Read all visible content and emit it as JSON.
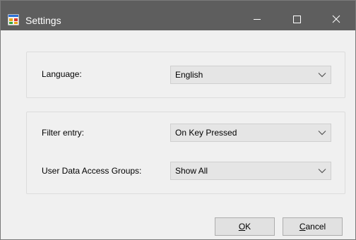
{
  "window": {
    "title": "Settings",
    "app_icon": "settings-app-icon",
    "controls": {
      "minimize_icon": "minimize-icon",
      "maximize_icon": "maximize-icon",
      "close_icon": "close-icon"
    }
  },
  "language_group": {
    "language_label": "Language:",
    "language_value": "English"
  },
  "filter_group": {
    "filter_label": "Filter entry:",
    "filter_value": "On Key Pressed",
    "groups_label": "User Data Access Groups:",
    "groups_value": "Show All"
  },
  "footer": {
    "ok_mnemonic": "O",
    "ok_rest": "K",
    "cancel_mnemonic": "C",
    "cancel_rest": "ancel"
  },
  "colors": {
    "titlebar": "#5e5e5e",
    "dialog_bg": "#f0f0f0",
    "combo_bg": "#e5e5e5",
    "button_bg": "#e1e1e1"
  }
}
